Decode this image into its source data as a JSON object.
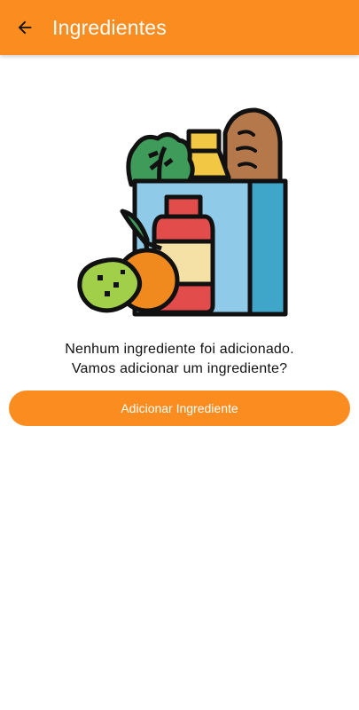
{
  "app_bar": {
    "title": "Ingredientes",
    "back_icon": "arrow-left-icon"
  },
  "empty_state": {
    "illustration": "grocery-bag-icon",
    "line1": "Nenhum ingrediente foi adicionado.",
    "line2": "Vamos adicionar um ingrediente?"
  },
  "actions": {
    "add_label": "Adicionar Ingrediente"
  },
  "colors": {
    "primary": "#fb8c1f",
    "text": "#111111",
    "background": "#ffffff"
  }
}
